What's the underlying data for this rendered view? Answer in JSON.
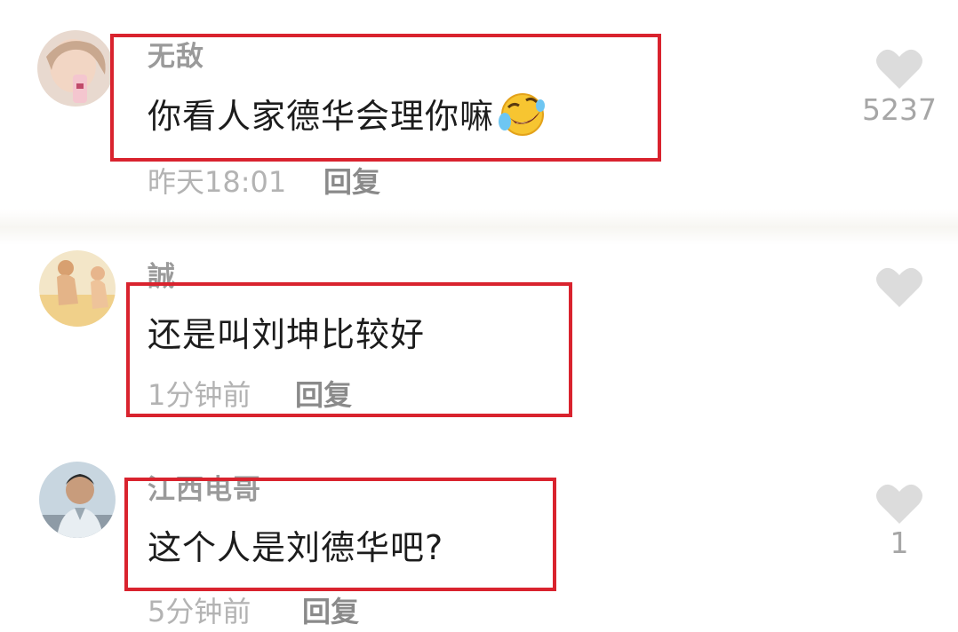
{
  "comments": [
    {
      "username": "无敌",
      "text": "你看人家德华会理你嘛",
      "emoji": "rofl-emoji",
      "time": "昨天18:01",
      "reply": "回复",
      "likes": "5237"
    },
    {
      "username": "誠",
      "text": "还是叫刘坤比较好",
      "time": "1分钟前",
      "reply": "回复",
      "likes": ""
    },
    {
      "username": "江西电哥",
      "text": "这个人是刘德华吧?",
      "time": "5分钟前",
      "reply": "回复",
      "likes": "1"
    }
  ],
  "colors": {
    "highlight": "#d9232e",
    "heart": "#dcdcdc"
  },
  "icons": [
    "heart-icon",
    "rofl-emoji"
  ]
}
